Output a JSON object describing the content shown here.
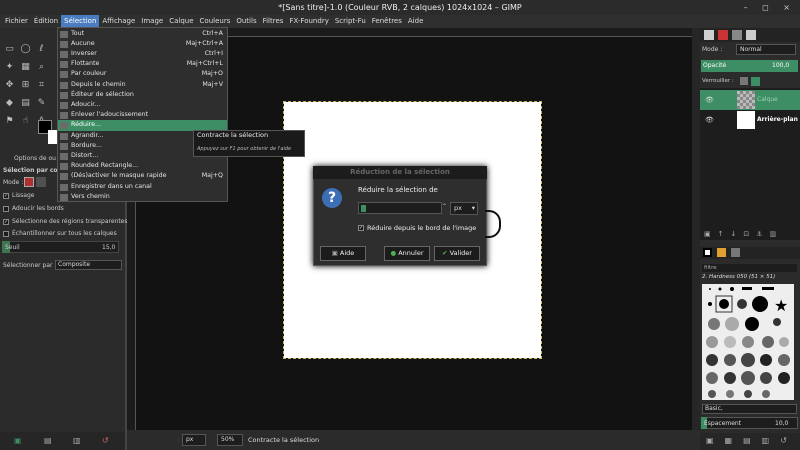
{
  "window": {
    "title": "*[Sans titre]-1.0 (Couleur RVB, 2 calques) 1024x1024 – GIMP",
    "controls": "– ◻ ×"
  },
  "menubar": [
    "Fichier",
    "Édition",
    "Sélection",
    "Affichage",
    "Image",
    "Calque",
    "Couleurs",
    "Outils",
    "Filtres",
    "FX-Foundry",
    "Script-Fu",
    "Fenêtres",
    "Aide"
  ],
  "selection_menu": {
    "items": [
      {
        "label": "Tout",
        "shortcut": "Ctrl+A"
      },
      {
        "label": "Aucune",
        "shortcut": "Maj+Ctrl+A"
      },
      {
        "label": "Inverser",
        "shortcut": "Ctrl+I"
      },
      {
        "label": "Flottante",
        "shortcut": "Maj+Ctrl+L"
      },
      {
        "label": "Par couleur",
        "shortcut": "Maj+O"
      },
      {
        "label": "Depuis le chemin",
        "shortcut": "Maj+V"
      },
      {
        "label": "Éditeur de sélection",
        "shortcut": ""
      },
      {
        "label": "Adoucir...",
        "shortcut": ""
      },
      {
        "label": "Enlever l'adoucissement",
        "shortcut": ""
      },
      {
        "label": "Réduire...",
        "shortcut": ""
      },
      {
        "label": "Agrandir...",
        "shortcut": ""
      },
      {
        "label": "Bordure...",
        "shortcut": ""
      },
      {
        "label": "Distort...",
        "shortcut": ""
      },
      {
        "label": "Rounded Rectangle...",
        "shortcut": ""
      },
      {
        "label": "(Dés)activer le masque rapide",
        "shortcut": "Maj+Q"
      },
      {
        "label": "Enregistrer dans un canal",
        "shortcut": ""
      },
      {
        "label": "Vers chemin",
        "shortcut": ""
      }
    ],
    "active_index": 9
  },
  "tooltip": {
    "title": "Contracte la sélection",
    "help": "Appuyez sur F1 pour obtenir de l'aide"
  },
  "tool_options": {
    "tab_title": "Options de ou",
    "tool_name": "Sélection par cou",
    "mode_label": "Mode :",
    "lissage": "Lissage",
    "adoucir": "Adoucir les bords",
    "transparentes": "Sélectionne des régions transparentes",
    "echantillonner": "Échantillonner sur tous les calques",
    "seuil_label": "Seuil",
    "seuil_value": "15,0",
    "selection_par_label": "Sélectionner par :",
    "selection_par_value": "Composite"
  },
  "dialog": {
    "title": "Réduction de la sélection",
    "label": "Réduire la sélection de",
    "value": "",
    "unit": "px",
    "checkbox": "Réduire depuis le bord de l'image",
    "btn_help": "Aide",
    "btn_cancel": "Annuler",
    "btn_ok": "Valider"
  },
  "status": {
    "unit": "px",
    "zoom": "50%",
    "message": "Contracte la sélection"
  },
  "layers": {
    "mode_label": "Mode :",
    "mode_value": "Normal",
    "opacity_label": "Opacité",
    "opacity_value": "100,0",
    "lock_label": "Verrouiller :",
    "items": [
      {
        "name": "Calque"
      },
      {
        "name": "Arrière-plan"
      }
    ]
  },
  "brushes": {
    "filter": "filtre",
    "current": "2. Hardness 050 (51 × 51)",
    "category": "Basic,",
    "spacing_label": "Espacement",
    "spacing_value": "10,0"
  },
  "colors": {
    "accent": "#3e8e65",
    "menu_active": "#4a7cc0"
  }
}
